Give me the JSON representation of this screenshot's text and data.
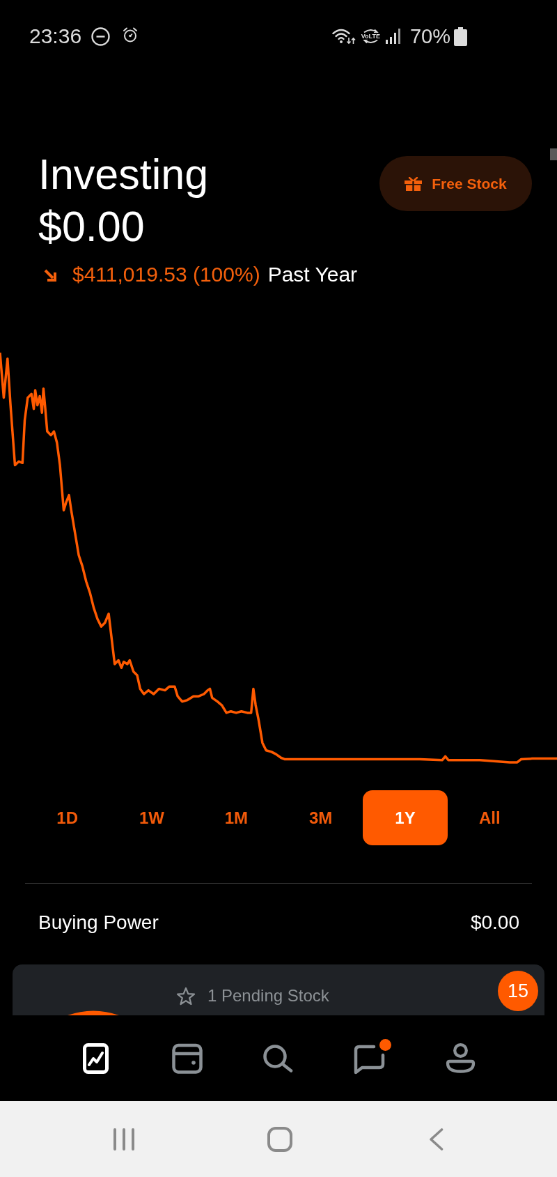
{
  "status_bar": {
    "time": "23:36",
    "network_label": "VoLTE",
    "battery": "70%"
  },
  "header": {
    "title": "Investing",
    "value": "$0.00",
    "change": {
      "negative": true,
      "amount": "$411,019.53 (100%)",
      "period": "Past Year"
    },
    "free_stock_button": "Free Stock"
  },
  "range_tabs": [
    {
      "label": "1D",
      "selected": false
    },
    {
      "label": "1W",
      "selected": false
    },
    {
      "label": "1M",
      "selected": false
    },
    {
      "label": "3M",
      "selected": false
    },
    {
      "label": "1Y",
      "selected": true
    },
    {
      "label": "All",
      "selected": false
    }
  ],
  "buying_power": {
    "label": "Buying Power",
    "value": "$0.00"
  },
  "pending_card": {
    "label": "1 Pending Stock",
    "badge": "15"
  },
  "bottom_nav": [
    {
      "selected": true,
      "notification": false
    },
    {
      "selected": false,
      "notification": false
    },
    {
      "selected": false,
      "notification": false
    },
    {
      "selected": false,
      "notification": true
    },
    {
      "selected": false,
      "notification": false
    }
  ]
}
